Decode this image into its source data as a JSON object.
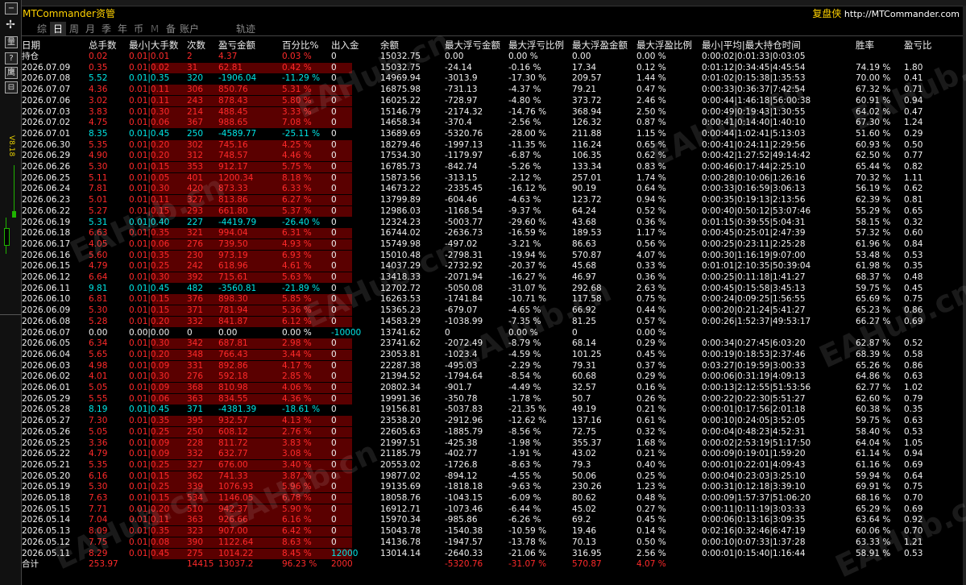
{
  "app": {
    "title": "MTCommander资管",
    "brand_cn": "复盘侠",
    "brand_url": "http://MTCommander.com"
  },
  "sidebar": {
    "buttons": [
      "−",
      "✢",
      "量",
      "?",
      "鹰",
      "⊟"
    ],
    "vertical_label": "V8.18"
  },
  "tabs": [
    {
      "label": "综",
      "state": "normal"
    },
    {
      "label": "日",
      "state": "active"
    },
    {
      "label": "周",
      "state": "normal"
    },
    {
      "label": "月",
      "state": "normal"
    },
    {
      "label": "季",
      "state": "normal"
    },
    {
      "label": "年",
      "state": "normal"
    },
    {
      "label": "币",
      "state": "normal"
    },
    {
      "label": "M",
      "state": "dim"
    },
    {
      "label": "备",
      "state": "normal"
    },
    {
      "label": "账户",
      "state": "normal"
    },
    {
      "label": "轨迹",
      "state": "extra"
    }
  ],
  "columns": [
    "日期",
    "总手数",
    "最小|大手数",
    "次数",
    "盈亏金额",
    "百分比%",
    "出入金",
    "余额",
    "最大浮亏金额",
    "最大浮亏比例",
    "最大浮盈金额",
    "最大浮盈比例",
    "最小|平均|最大持仓时间",
    "胜率",
    "盈亏比"
  ],
  "rows": [
    {
      "d": "持仓",
      "l": "0.02",
      "mm": "0.01|0.01",
      "n": "2",
      "p": "4.37",
      "pct": "0.03 %",
      "io": "0",
      "bal": "15032.75",
      "fl": "0.00",
      "flp": "0.00 %",
      "fp": "0.00",
      "fpp": "0.00 %",
      "t": "0:00:02|0:01:33|0:03:05",
      "w": "",
      "r": "",
      "k": "pos"
    },
    {
      "d": "2026.07.09",
      "l": "0.35",
      "mm": "0.01|0.02",
      "n": "31",
      "p": "62.81",
      "pct": "0.42 %",
      "io": "0",
      "bal": "15032.75",
      "fl": "-24.14",
      "flp": "-0.16 %",
      "fp": "17.34",
      "fpp": "0.12 %",
      "t": "0:01:12|0:34:45|4:45:54",
      "w": "74.19 %",
      "r": "1.80",
      "k": "pos"
    },
    {
      "d": "2026.07.08",
      "l": "5.52",
      "mm": "0.01|0.35",
      "n": "320",
      "p": "-1906.04",
      "pct": "-11.29 %",
      "io": "0",
      "bal": "14969.94",
      "fl": "-3013.9",
      "flp": "-17.30 %",
      "fp": "209.57",
      "fpp": "1.44 %",
      "t": "0:01:02|0:15:38|1:35:53",
      "w": "70.00 %",
      "r": "0.41",
      "k": "neg"
    },
    {
      "d": "2026.07.07",
      "l": "4.36",
      "mm": "0.01|0.11",
      "n": "306",
      "p": "850.76",
      "pct": "5.31 %",
      "io": "0",
      "bal": "16875.98",
      "fl": "-731.13",
      "flp": "-4.37 %",
      "fp": "79.21",
      "fpp": "0.47 %",
      "t": "0:00:33|0:36:37|7:42:54",
      "w": "67.32 %",
      "r": "0.71",
      "k": "pos"
    },
    {
      "d": "2026.07.06",
      "l": "3.02",
      "mm": "0.01|0.11",
      "n": "243",
      "p": "878.43",
      "pct": "5.80 %",
      "io": "0",
      "bal": "16025.22",
      "fl": "-728.97",
      "flp": "-4.80 %",
      "fp": "373.72",
      "fpp": "2.46 %",
      "t": "0:00:44|1:46:18|56:00:38",
      "w": "60.91 %",
      "r": "0.94",
      "k": "pos"
    },
    {
      "d": "2026.07.03",
      "l": "3.83",
      "mm": "0.01|0.30",
      "n": "214",
      "p": "488.45",
      "pct": "3.33 %",
      "io": "0",
      "bal": "15146.79",
      "fl": "-2174.32",
      "flp": "-14.76 %",
      "fp": "368.94",
      "fpp": "2.50 %",
      "t": "0:00:49|0:19:43|1:30:55",
      "w": "64.02 %",
      "r": "0.47",
      "k": "pos"
    },
    {
      "d": "2026.07.02",
      "l": "4.75",
      "mm": "0.01|0.06",
      "n": "367",
      "p": "988.65",
      "pct": "7.08 %",
      "io": "0",
      "bal": "14658.34",
      "fl": "-370.4",
      "flp": "-2.56 %",
      "fp": "126.32",
      "fpp": "0.87 %",
      "t": "0:00:41|0:14:40|1:40:10",
      "w": "67.30 %",
      "r": "1.24",
      "k": "pos"
    },
    {
      "d": "2026.07.01",
      "l": "8.35",
      "mm": "0.01|0.45",
      "n": "250",
      "p": "-4589.77",
      "pct": "-25.11 %",
      "io": "0",
      "bal": "13689.69",
      "fl": "-5320.76",
      "flp": "-28.00 %",
      "fp": "211.88",
      "fpp": "1.15 %",
      "t": "0:00:44|1:02:41|5:13:03",
      "w": "51.60 %",
      "r": "0.29",
      "k": "neg"
    },
    {
      "d": "2026.06.30",
      "l": "5.35",
      "mm": "0.01|0.20",
      "n": "302",
      "p": "745.16",
      "pct": "4.25 %",
      "io": "0",
      "bal": "18279.46",
      "fl": "-1997.13",
      "flp": "-11.35 %",
      "fp": "116.24",
      "fpp": "0.65 %",
      "t": "0:00:41|0:24:11|2:29:56",
      "w": "60.93 %",
      "r": "0.50",
      "k": "pos"
    },
    {
      "d": "2026.06.29",
      "l": "4.90",
      "mm": "0.01|0.20",
      "n": "312",
      "p": "748.57",
      "pct": "4.46 %",
      "io": "0",
      "bal": "17534.30",
      "fl": "-1179.97",
      "flp": "-6.87 %",
      "fp": "106.35",
      "fpp": "0.62 %",
      "t": "0:00:42|1:27:52|49:14:42",
      "w": "62.50 %",
      "r": "0.77",
      "k": "pos"
    },
    {
      "d": "2026.06.26",
      "l": "5.30",
      "mm": "0.01|0.15",
      "n": "353",
      "p": "912.17",
      "pct": "5.75 %",
      "io": "0",
      "bal": "16785.73",
      "fl": "-842.74",
      "flp": "-5.26 %",
      "fp": "133.34",
      "fpp": "0.83 %",
      "t": "0:00:46|0:17:44|2:25:10",
      "w": "65.44 %",
      "r": "0.82",
      "k": "pos"
    },
    {
      "d": "2026.06.25",
      "l": "5.11",
      "mm": "0.01|0.05",
      "n": "401",
      "p": "1200.34",
      "pct": "8.18 %",
      "io": "0",
      "bal": "15873.56",
      "fl": "-313.15",
      "flp": "-2.12 %",
      "fp": "257.01",
      "fpp": "1.74 %",
      "t": "0:00:28|0:10:06|1:26:16",
      "w": "70.32 %",
      "r": "1.11",
      "k": "pos"
    },
    {
      "d": "2026.06.24",
      "l": "7.81",
      "mm": "0.01|0.30",
      "n": "420",
      "p": "873.33",
      "pct": "6.33 %",
      "io": "0",
      "bal": "14673.22",
      "fl": "-2335.45",
      "flp": "-16.12 %",
      "fp": "90.19",
      "fpp": "0.64 %",
      "t": "0:00:33|0:16:59|3:06:13",
      "w": "56.19 %",
      "r": "0.62",
      "k": "pos"
    },
    {
      "d": "2026.06.23",
      "l": "5.01",
      "mm": "0.01|0.11",
      "n": "327",
      "p": "813.86",
      "pct": "6.27 %",
      "io": "0",
      "bal": "13799.89",
      "fl": "-604.46",
      "flp": "-4.63 %",
      "fp": "123.72",
      "fpp": "0.94 %",
      "t": "0:00:35|0:19:13|2:13:56",
      "w": "62.39 %",
      "r": "0.81",
      "k": "pos"
    },
    {
      "d": "2026.06.22",
      "l": "5.27",
      "mm": "0.01|0.15",
      "n": "293",
      "p": "661.80",
      "pct": "5.37 %",
      "io": "0",
      "bal": "12986.03",
      "fl": "-1168.54",
      "flp": "-9.37 %",
      "fp": "64.24",
      "fpp": "0.52 %",
      "t": "0:00:40|0:50:12|53:07:46",
      "w": "55.29 %",
      "r": "0.65",
      "k": "pos"
    },
    {
      "d": "2026.06.19",
      "l": "5.31",
      "mm": "0.01|0.40",
      "n": "227",
      "p": "-4419.79",
      "pct": "-26.40 %",
      "io": "0",
      "bal": "12324.23",
      "fl": "-5003.77",
      "flp": "-29.60 %",
      "fp": "43.68",
      "fpp": "0.36 %",
      "t": "0:01:15|0:39:55|5:04:31",
      "w": "58.15 %",
      "r": "0.32",
      "k": "neg"
    },
    {
      "d": "2026.06.18",
      "l": "6.63",
      "mm": "0.01|0.35",
      "n": "321",
      "p": "994.04",
      "pct": "6.31 %",
      "io": "0",
      "bal": "16744.02",
      "fl": "-2636.73",
      "flp": "-16.59 %",
      "fp": "189.53",
      "fpp": "1.17 %",
      "t": "0:00:45|0:25:01|2:47:39",
      "w": "57.32 %",
      "r": "0.60",
      "k": "pos"
    },
    {
      "d": "2026.06.17",
      "l": "4.05",
      "mm": "0.01|0.06",
      "n": "276",
      "p": "739.50",
      "pct": "4.93 %",
      "io": "0",
      "bal": "15749.98",
      "fl": "-497.02",
      "flp": "-3.21 %",
      "fp": "86.63",
      "fpp": "0.56 %",
      "t": "0:00:25|0:23:11|2:25:28",
      "w": "61.96 %",
      "r": "0.84",
      "k": "pos"
    },
    {
      "d": "2026.06.16",
      "l": "5.60",
      "mm": "0.01|0.35",
      "n": "230",
      "p": "973.19",
      "pct": "6.93 %",
      "io": "0",
      "bal": "15010.48",
      "fl": "-2798.31",
      "flp": "-19.94 %",
      "fp": "570.87",
      "fpp": "4.07 %",
      "t": "0:00:30|1:16:19|9:07:00",
      "w": "53.48 %",
      "r": "0.53",
      "k": "pos"
    },
    {
      "d": "2026.06.15",
      "l": "4.79",
      "mm": "0.01|0.25",
      "n": "242",
      "p": "618.96",
      "pct": "4.61 %",
      "io": "0",
      "bal": "14037.29",
      "fl": "-2732.92",
      "flp": "-20.37 %",
      "fp": "45.68",
      "fpp": "0.33 %",
      "t": "0:01:01|2:10:35|50:39:04",
      "w": "61.98 %",
      "r": "0.35",
      "k": "pos"
    },
    {
      "d": "2026.06.12",
      "l": "6.64",
      "mm": "0.01|0.30",
      "n": "392",
      "p": "715.61",
      "pct": "5.63 %",
      "io": "0",
      "bal": "13418.33",
      "fl": "-2071.94",
      "flp": "-16.27 %",
      "fp": "46.97",
      "fpp": "0.36 %",
      "t": "0:00:25|0:11:18|1:41:27",
      "w": "68.37 %",
      "r": "0.48",
      "k": "pos"
    },
    {
      "d": "2026.06.11",
      "l": "9.81",
      "mm": "0.01|0.45",
      "n": "482",
      "p": "-3560.81",
      "pct": "-21.89 %",
      "io": "0",
      "bal": "12702.72",
      "fl": "-5050.08",
      "flp": "-31.07 %",
      "fp": "292.68",
      "fpp": "2.63 %",
      "t": "0:00:45|0:15:58|3:45:13",
      "w": "59.75 %",
      "r": "0.45",
      "k": "neg"
    },
    {
      "d": "2026.06.10",
      "l": "6.81",
      "mm": "0.01|0.15",
      "n": "376",
      "p": "898.30",
      "pct": "5.85 %",
      "io": "0",
      "bal": "16263.53",
      "fl": "-1741.84",
      "flp": "-10.71 %",
      "fp": "117.58",
      "fpp": "0.75 %",
      "t": "0:00:24|0:09:25|1:56:55",
      "w": "65.69 %",
      "r": "0.75",
      "k": "pos"
    },
    {
      "d": "2026.06.09",
      "l": "5.30",
      "mm": "0.01|0.15",
      "n": "371",
      "p": "781.94",
      "pct": "5.36 %",
      "io": "0",
      "bal": "15365.23",
      "fl": "-679.07",
      "flp": "-4.65 %",
      "fp": "66.92",
      "fpp": "0.44 %",
      "t": "0:00:20|0:21:24|5:41:27",
      "w": "65.23 %",
      "r": "0.86",
      "k": "pos"
    },
    {
      "d": "2026.06.08",
      "l": "5.28",
      "mm": "0.01|0.20",
      "n": "332",
      "p": "841.87",
      "pct": "6.12 %",
      "io": "0",
      "bal": "14583.29",
      "fl": "-1038.99",
      "flp": "-7.35 %",
      "fp": "81.25",
      "fpp": "0.57 %",
      "t": "0:00:26|1:52:37|49:53:17",
      "w": "66.27 %",
      "r": "0.69",
      "k": "pos"
    },
    {
      "d": "2026.06.07",
      "l": "0.00",
      "mm": "0.00|0.00",
      "n": "0",
      "p": "0.00",
      "pct": "0.00 %",
      "io": "-10000",
      "bal": "13741.62",
      "fl": "0",
      "flp": "0.00 %",
      "fp": "0",
      "fpp": "0.00 %",
      "t": "",
      "w": "",
      "r": "",
      "k": "zero"
    },
    {
      "d": "2026.06.05",
      "l": "6.34",
      "mm": "0.01|0.30",
      "n": "342",
      "p": "687.81",
      "pct": "2.98 %",
      "io": "0",
      "bal": "23741.62",
      "fl": "-2072.49",
      "flp": "-8.79 %",
      "fp": "68.14",
      "fpp": "0.29 %",
      "t": "0:00:34|0:27:45|6:03:20",
      "w": "62.87 %",
      "r": "0.52",
      "k": "pos"
    },
    {
      "d": "2026.06.04",
      "l": "5.65",
      "mm": "0.01|0.20",
      "n": "348",
      "p": "766.43",
      "pct": "3.44 %",
      "io": "0",
      "bal": "23053.81",
      "fl": "-1023.4",
      "flp": "-4.59 %",
      "fp": "101.25",
      "fpp": "0.45 %",
      "t": "0:00:19|0:18:53|2:37:46",
      "w": "68.39 %",
      "r": "0.58",
      "k": "pos"
    },
    {
      "d": "2026.06.03",
      "l": "4.98",
      "mm": "0.01|0.09",
      "n": "331",
      "p": "892.86",
      "pct": "4.17 %",
      "io": "0",
      "bal": "22287.38",
      "fl": "-495.03",
      "flp": "-2.29 %",
      "fp": "79.31",
      "fpp": "0.37 %",
      "t": "0:03:27|0:19:59|3:00:33",
      "w": "65.26 %",
      "r": "0.86",
      "k": "pos"
    },
    {
      "d": "2026.06.02",
      "l": "4.01",
      "mm": "0.01|0.30",
      "n": "276",
      "p": "592.18",
      "pct": "2.85 %",
      "io": "0",
      "bal": "21394.52",
      "fl": "-1794.64",
      "flp": "-8.54 %",
      "fp": "60.68",
      "fpp": "0.29 %",
      "t": "0:00:06|0:31:19|4:09:13",
      "w": "64.86 %",
      "r": "0.63",
      "k": "pos"
    },
    {
      "d": "2026.06.01",
      "l": "5.05",
      "mm": "0.01|0.09",
      "n": "368",
      "p": "810.98",
      "pct": "4.06 %",
      "io": "0",
      "bal": "20802.34",
      "fl": "-901.7",
      "flp": "-4.49 %",
      "fp": "32.57",
      "fpp": "0.16 %",
      "t": "0:00:13|2:12:55|51:53:56",
      "w": "62.77 %",
      "r": "1.02",
      "k": "pos"
    },
    {
      "d": "2026.05.29",
      "l": "5.55",
      "mm": "0.01|0.06",
      "n": "363",
      "p": "834.55",
      "pct": "4.36 %",
      "io": "0",
      "bal": "19991.36",
      "fl": "-350.78",
      "flp": "-1.78 %",
      "fp": "50.7",
      "fpp": "0.26 %",
      "t": "0:00:22|0:22:30|5:51:27",
      "w": "62.60 %",
      "r": "0.79",
      "k": "pos"
    },
    {
      "d": "2026.05.28",
      "l": "8.19",
      "mm": "0.01|0.45",
      "n": "371",
      "p": "-4381.39",
      "pct": "-18.61 %",
      "io": "0",
      "bal": "19156.81",
      "fl": "-5037.83",
      "flp": "-21.35 %",
      "fp": "49.19",
      "fpp": "0.21 %",
      "t": "0:00:01|0:17:56|2:01:18",
      "w": "60.38 %",
      "r": "0.35",
      "k": "neg"
    },
    {
      "d": "2026.05.27",
      "l": "7.30",
      "mm": "0.01|0.35",
      "n": "395",
      "p": "932.57",
      "pct": "4.13 %",
      "io": "0",
      "bal": "23538.20",
      "fl": "-2912.96",
      "flp": "-12.62 %",
      "fp": "137.16",
      "fpp": "0.61 %",
      "t": "0:00:10|0:24:05|3:52:05",
      "w": "59.75 %",
      "r": "0.63",
      "k": "pos"
    },
    {
      "d": "2026.05.26",
      "l": "5.05",
      "mm": "0.01|0.25",
      "n": "250",
      "p": "608.12",
      "pct": "2.76 %",
      "io": "0",
      "bal": "22605.63",
      "fl": "-1885.79",
      "flp": "-8.56 %",
      "fp": "72.75",
      "fpp": "0.32 %",
      "t": "0:00:04|0:48:23|4:52:31",
      "w": "58.40 %",
      "r": "0.53",
      "k": "pos"
    },
    {
      "d": "2026.05.25",
      "l": "3.36",
      "mm": "0.01|0.09",
      "n": "228",
      "p": "811.72",
      "pct": "3.83 %",
      "io": "0",
      "bal": "21997.51",
      "fl": "-425.38",
      "flp": "-1.98 %",
      "fp": "355.37",
      "fpp": "1.68 %",
      "t": "0:00:02|2:53:19|51:17:50",
      "w": "64.04 %",
      "r": "1.05",
      "k": "pos"
    },
    {
      "d": "2026.05.22",
      "l": "4.79",
      "mm": "0.01|0.09",
      "n": "332",
      "p": "632.77",
      "pct": "3.08 %",
      "io": "0",
      "bal": "21185.79",
      "fl": "-402.77",
      "flp": "-1.91 %",
      "fp": "43.02",
      "fpp": "0.21 %",
      "t": "0:00:09|0:19:01|1:59:20",
      "w": "61.14 %",
      "r": "0.94",
      "k": "pos"
    },
    {
      "d": "2026.05.21",
      "l": "5.35",
      "mm": "0.01|0.25",
      "n": "327",
      "p": "676.00",
      "pct": "3.40 %",
      "io": "0",
      "bal": "20553.02",
      "fl": "-1726.8",
      "flp": "-8.63 %",
      "fp": "79.3",
      "fpp": "0.40 %",
      "t": "0:00:01|0:22:01|4:09:43",
      "w": "61.16 %",
      "r": "0.69",
      "k": "pos"
    },
    {
      "d": "2026.05.20",
      "l": "6.16",
      "mm": "0.01|0.15",
      "n": "362",
      "p": "741.33",
      "pct": "3.87 %",
      "io": "0",
      "bal": "19877.02",
      "fl": "-894.12",
      "flp": "-4.55 %",
      "fp": "50.06",
      "fpp": "0.25 %",
      "t": "0:00:04|0:23:03|3:25:10",
      "w": "59.94 %",
      "r": "0.64",
      "k": "pos"
    },
    {
      "d": "2026.05.19",
      "l": "5.30",
      "mm": "0.01|0.25",
      "n": "339",
      "p": "1076.93",
      "pct": "5.96 %",
      "io": "0",
      "bal": "19135.69",
      "fl": "-1818.18",
      "flp": "-9.63 %",
      "fp": "230.26",
      "fpp": "1.23 %",
      "t": "0:00:31|0:12:18|3:39:10",
      "w": "69.91 %",
      "r": "0.75",
      "k": "pos"
    },
    {
      "d": "2026.05.18",
      "l": "7.63",
      "mm": "0.01|0.15",
      "n": "534",
      "p": "1146.05",
      "pct": "6.78 %",
      "io": "0",
      "bal": "18058.76",
      "fl": "-1043.15",
      "flp": "-6.09 %",
      "fp": "80.62",
      "fpp": "0.48 %",
      "t": "0:00:09|1:57:37|51:06:20",
      "w": "68.16 %",
      "r": "0.70",
      "k": "pos"
    },
    {
      "d": "2026.05.15",
      "l": "7.71",
      "mm": "0.01|0.20",
      "n": "510",
      "p": "942.37",
      "pct": "5.90 %",
      "io": "0",
      "bal": "16912.71",
      "fl": "-1073.46",
      "flp": "-6.44 %",
      "fp": "45.02",
      "fpp": "0.27 %",
      "t": "0:00:11|0:11:19|3:03:33",
      "w": "65.29 %",
      "r": "0.69",
      "k": "pos"
    },
    {
      "d": "2026.05.14",
      "l": "7.04",
      "mm": "0.01|0.11",
      "n": "363",
      "p": "926.66",
      "pct": "6.16 %",
      "io": "0",
      "bal": "15970.34",
      "fl": "-985.86",
      "flp": "-6.26 %",
      "fp": "69.2",
      "fpp": "0.45 %",
      "t": "0:00:06|0:13:16|3:09:35",
      "w": "63.64 %",
      "r": "0.92",
      "k": "pos"
    },
    {
      "d": "2026.05.13",
      "l": "8.09",
      "mm": "0.01|0.35",
      "n": "323",
      "p": "907.00",
      "pct": "6.42 %",
      "io": "0",
      "bal": "15043.78",
      "fl": "-1540.38",
      "flp": "-10.59 %",
      "fp": "19.46",
      "fpp": "0.14 %",
      "t": "0:02:16|0:32:46|6:47:19",
      "w": "60.06 %",
      "r": "0.70",
      "k": "pos"
    },
    {
      "d": "2026.05.12",
      "l": "7.75",
      "mm": "0.01|0.08",
      "n": "390",
      "p": "1122.64",
      "pct": "8.63 %",
      "io": "0",
      "bal": "14136.78",
      "fl": "-1947.57",
      "flp": "-13.78 %",
      "fp": "70.13",
      "fpp": "0.50 %",
      "t": "0:00:10|0:07:33|1:37:28",
      "w": "63.33 %",
      "r": "1.21",
      "k": "pos"
    },
    {
      "d": "2026.05.11",
      "l": "8.29",
      "mm": "0.01|0.45",
      "n": "275",
      "p": "1014.22",
      "pct": "8.45 %",
      "io": "12000",
      "bal": "13014.14",
      "fl": "-2640.33",
      "flp": "-21.06 %",
      "fp": "316.95",
      "fpp": "2.56 %",
      "t": "0:00:01|0:15:40|1:16:44",
      "w": "58.91 %",
      "r": "0.53",
      "k": "pos"
    }
  ],
  "total": {
    "d": "合计",
    "l": "253.97",
    "mm": "",
    "n": "14415",
    "p": "13037.2",
    "pct": "96.23 %",
    "io": "2000",
    "bal": "",
    "fl": "-5320.76",
    "flp": "-31.07 %",
    "fp": "570.87",
    "fpp": "4.07 %",
    "t": "",
    "w": "",
    "r": ""
  },
  "colors": {
    "positive": "#ff2a2a",
    "negative": "#00e6e6",
    "neutral": "#f0f0f0",
    "title": "#ffd200"
  }
}
